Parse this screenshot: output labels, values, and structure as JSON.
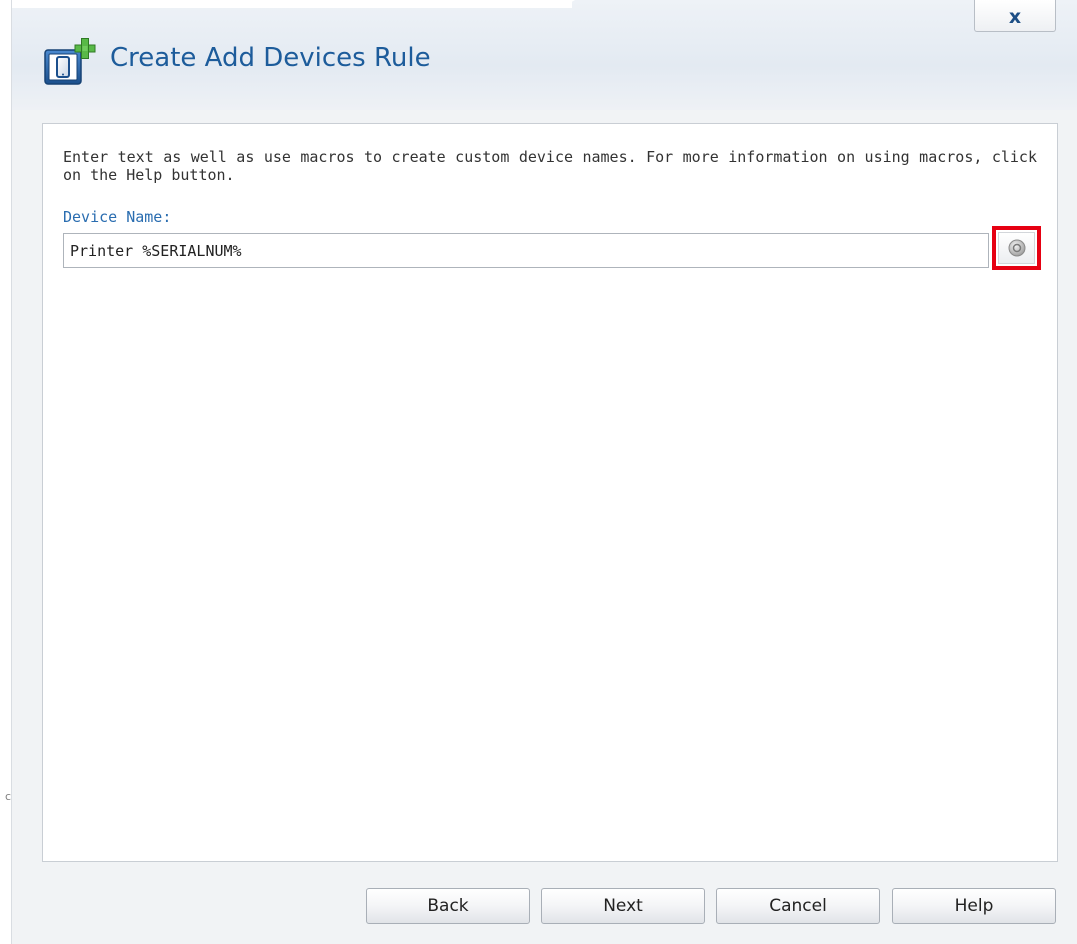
{
  "dialog": {
    "title": "Create Add Devices Rule",
    "close_label": "x",
    "title_icon": "add-device-icon",
    "close_icon": "close-icon"
  },
  "content": {
    "instructions": "Enter text as well as use macros to create custom device names. For more information on using macros, click on the Help button.",
    "device_name_label": "Device Name:",
    "device_name_value": "Printer %SERIALNUM%",
    "macro_button_icon": "macro-selector-icon",
    "highlight_color": "#e60012"
  },
  "footer": {
    "back_label": "Back",
    "next_label": "Next",
    "cancel_label": "Cancel",
    "help_label": "Help"
  },
  "background_edge": {
    "stray_text": "c"
  },
  "colors": {
    "title_blue": "#1d5c9b",
    "label_blue": "#2a6db0",
    "close_blue": "#1d4f86"
  }
}
